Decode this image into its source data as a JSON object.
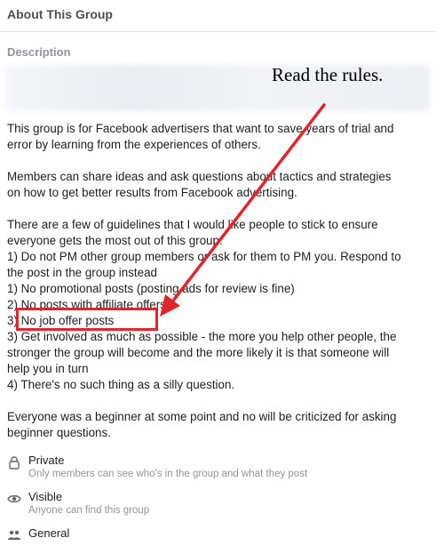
{
  "header": {
    "title": "About This Group"
  },
  "description": {
    "label": "Description",
    "annotation": "Read the rules.",
    "lines": [
      "This group is for Facebook advertisers that want to save years of trial and",
      "error by learning from the experiences of others.",
      "",
      "Members can share ideas and ask questions about tactics and strategies",
      "on how to get better results from Facebook advertising.",
      "",
      "There are a few of guidelines that I would like people to stick to ensure",
      "everyone gets the most out of this group:",
      "1) Do not PM other group members or ask for them to PM you. Respond to",
      "the post in the group instead",
      "1) No promotional posts (posting ads for review is fine)",
      "2) No posts with affiliate offers",
      "3) No job offer posts",
      "3) Get involved as much as possible - the more you help other people, the",
      "stronger the group will become and the more likely it is that someone will",
      "help you in turn",
      "4) There's no such thing as a silly question.",
      "",
      "Everyone was a beginner at some point and no will be criticized for asking",
      "beginner questions."
    ]
  },
  "privacy": {
    "title": "Private",
    "subtitle": "Only members can see who's in the group and what they post",
    "icon": "lock-icon"
  },
  "visibility": {
    "title": "Visible",
    "subtitle": "Anyone can find this group",
    "icon": "eye-icon"
  },
  "group_type": {
    "title": "General",
    "icon": "people-icon"
  },
  "colors": {
    "highlight": "#e0262a",
    "muted": "#90949c"
  }
}
